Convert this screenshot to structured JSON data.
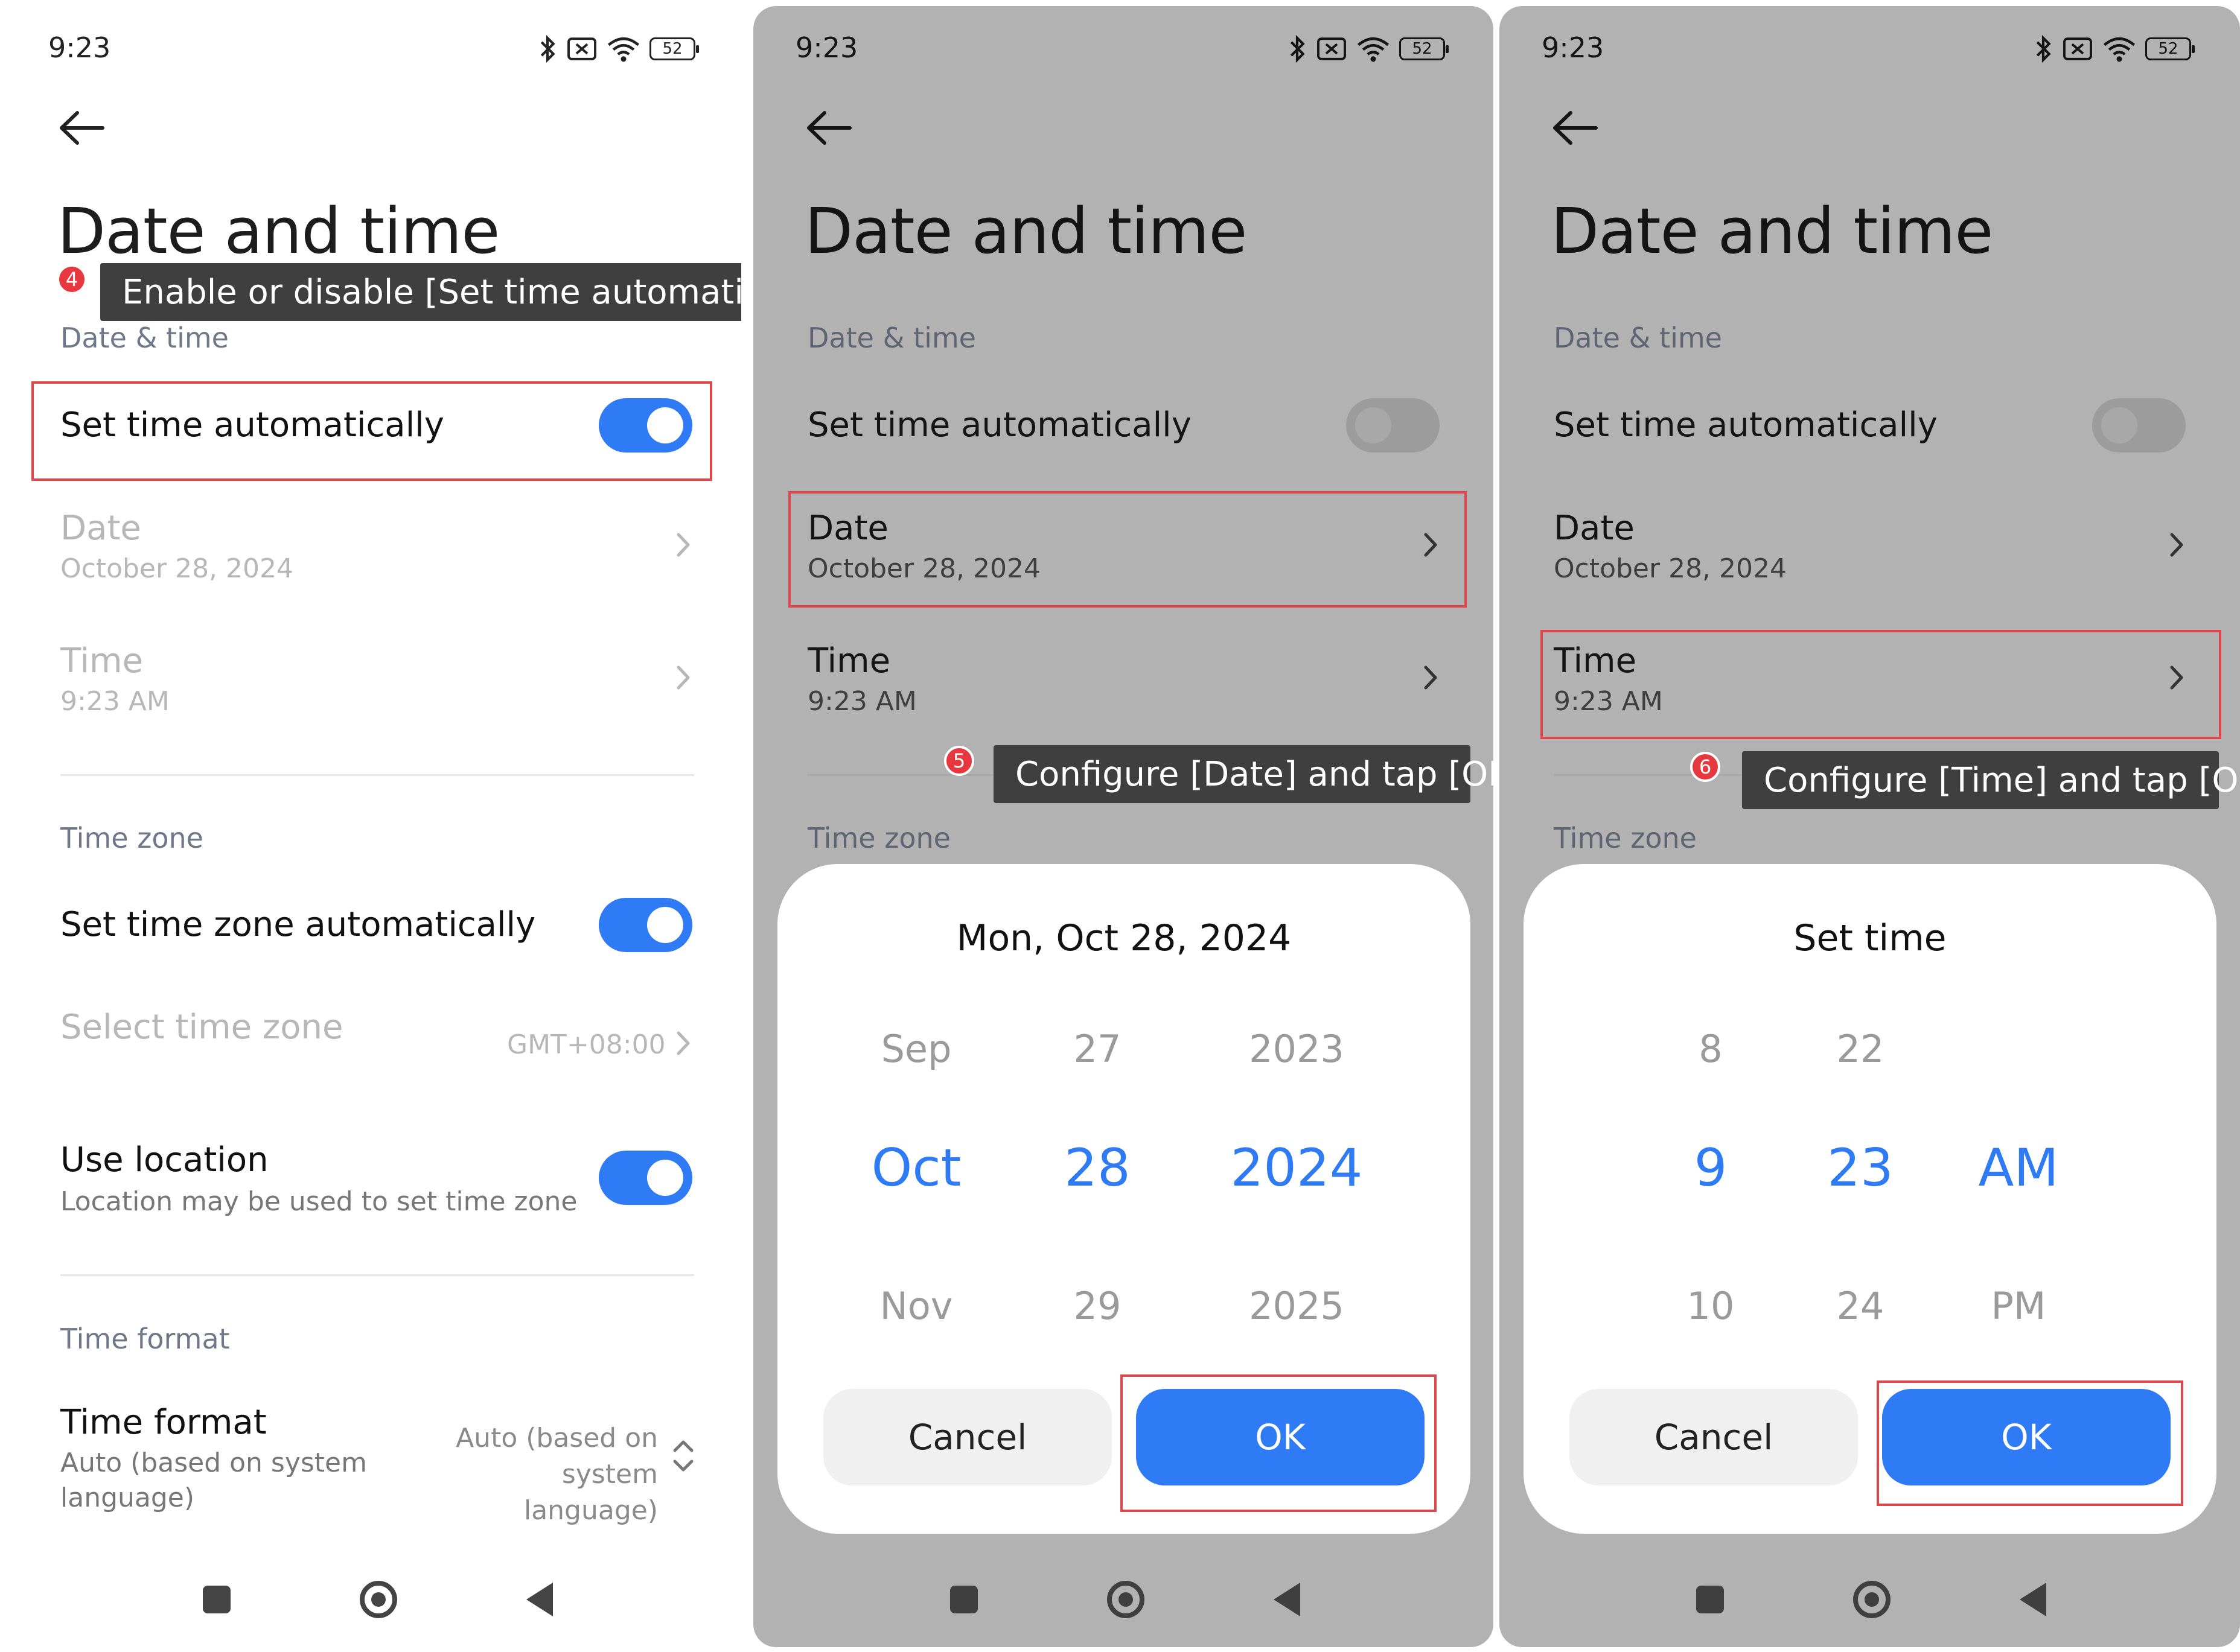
{
  "status_bar": {
    "time": "9:23",
    "battery": "52"
  },
  "panel1": {
    "title": "Date and time",
    "step_badge": "4",
    "tooltip": "Enable or disable [Set time automatically]",
    "section_date_time": "Date & time",
    "set_time_auto": {
      "label": "Set time automatically",
      "on": true
    },
    "date": {
      "label": "Date",
      "value": "October 28, 2024"
    },
    "time": {
      "label": "Time",
      "value": "9:23 AM"
    },
    "section_time_zone": "Time zone",
    "set_tz_auto": {
      "label": "Set time zone automatically",
      "on": true
    },
    "select_tz": {
      "label": "Select time zone",
      "value": "GMT+08:00"
    },
    "use_location": {
      "label": "Use location",
      "sub": "Location may be used to set time zone",
      "on": true
    },
    "section_time_format": "Time format",
    "time_format": {
      "label": "Time format",
      "sub": "Auto (based on system language)",
      "value": "Auto (based on system language)"
    }
  },
  "panel2": {
    "title": "Date and time",
    "section_date_time": "Date & time",
    "set_time_auto": {
      "label": "Set time automatically",
      "on": false
    },
    "date": {
      "label": "Date",
      "value": "October 28, 2024"
    },
    "time": {
      "label": "Time",
      "value": "9:23 AM"
    },
    "step_badge": "5",
    "tooltip": "Configure [Date] and tap [OK]",
    "section_time_zone": "Time zone",
    "dialog": {
      "title": "Mon, Oct 28, 2024",
      "month": {
        "prev": "Sep",
        "sel": "Oct",
        "next": "Nov"
      },
      "day": {
        "prev": "27",
        "sel": "28",
        "next": "29"
      },
      "year": {
        "prev": "2023",
        "sel": "2024",
        "next": "2025"
      },
      "cancel": "Cancel",
      "ok": "OK"
    }
  },
  "panel3": {
    "title": "Date and time",
    "section_date_time": "Date & time",
    "set_time_auto": {
      "label": "Set time automatically",
      "on": false
    },
    "date": {
      "label": "Date",
      "value": "October 28, 2024"
    },
    "time": {
      "label": "Time",
      "value": "9:23 AM"
    },
    "step_badge": "6",
    "tooltip": "Configure [Time] and tap [OK]",
    "section_time_zone": "Time zone",
    "dialog": {
      "title": "Set time",
      "hour": {
        "prev": "8",
        "sel": "9",
        "next": "10"
      },
      "minute": {
        "prev": "22",
        "sel": "23",
        "next": "24"
      },
      "ampm": {
        "sel": "AM",
        "next": "PM"
      },
      "cancel": "Cancel",
      "ok": "OK"
    }
  },
  "colors": {
    "accent": "#2f7bf5",
    "highlight": "#e0474c",
    "tooltip_bg": "#3f3f3f",
    "dim_overlay": "#b2b2b2"
  }
}
